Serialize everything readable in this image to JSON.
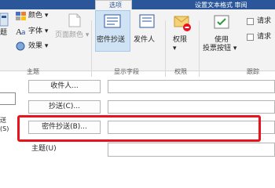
{
  "tabs": {
    "active": "选项",
    "right_partial": "设置文本格式 审阅"
  },
  "ribbon": {
    "theme_group": {
      "colors_label": "颜色",
      "fonts_label": "字体",
      "effects_label": "效果",
      "page_color_label": "页面颜色",
      "theme_partial": "题",
      "group_label": "主题"
    },
    "show_fields_group": {
      "bcc_label": "密件抄送",
      "from_label": "发件人",
      "group_label": "显示字段"
    },
    "permission_group": {
      "permission_label": "权限",
      "group_label": "权限"
    },
    "tracking_group": {
      "use_voting_label": "使用",
      "voting_buttons_label": "投票按钮",
      "request_label_1": "请求",
      "request_label_2": "请求",
      "group_label": "跟踪"
    }
  },
  "form": {
    "to_button": "收件人...",
    "cc_button": "抄送(C)...",
    "bcc_button": "密件抄送(B)...",
    "subject_label": "主题(U)",
    "send_partial_1": "送",
    "send_partial_2": "(S)"
  },
  "colors": {
    "accent": "#2b579a",
    "highlight": "#e8131c",
    "ribbon_bg": "#f3f3f3"
  }
}
